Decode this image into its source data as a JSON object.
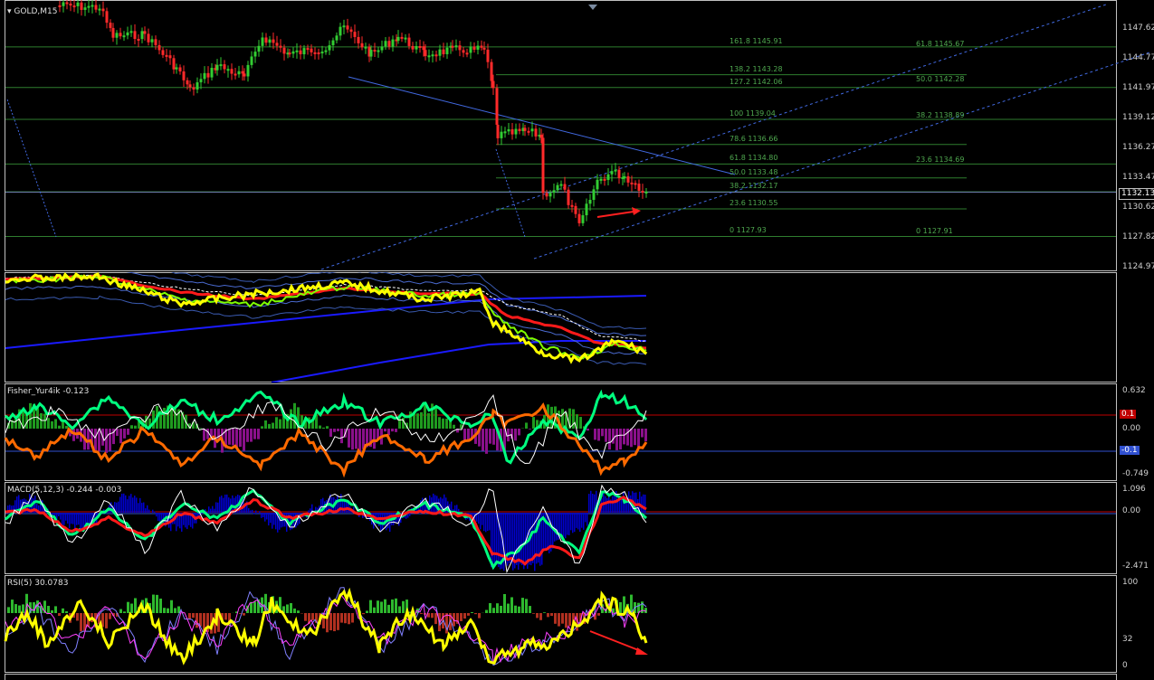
{
  "chart_title": "GOLD,M15",
  "price_axis": [
    "1147.62",
    "1144.77",
    "1141.97",
    "1139.12",
    "1136.27",
    "1133.47",
    "1130.62",
    "1127.82",
    "1124.97"
  ],
  "current_price": "1132.13",
  "fib_left": [
    {
      "label": "161.8 1145.91",
      "price": 1145.91
    },
    {
      "label": "138.2 1143.28",
      "price": 1143.28
    },
    {
      "label": "127.2 1142.06",
      "price": 1142.06
    },
    {
      "label": "100 1139.04",
      "price": 1139.04
    },
    {
      "label": "78.6 1136.66",
      "price": 1136.66
    },
    {
      "label": "61.8 1134.80",
      "price": 1134.8
    },
    {
      "label": "50.0 1133.48",
      "price": 1133.48
    },
    {
      "label": "38.2 1132.17",
      "price": 1132.17
    },
    {
      "label": "23.6 1130.55",
      "price": 1130.55
    },
    {
      "label": "0 1127.93",
      "price": 1127.93
    }
  ],
  "fib_right": [
    {
      "label": "61.8 1145.67",
      "price": 1145.67
    },
    {
      "label": "50.0 1142.28",
      "price": 1142.28
    },
    {
      "label": "38.2 1138.89",
      "price": 1138.89
    },
    {
      "label": "23.6 1134.69",
      "price": 1134.69
    },
    {
      "label": "0 1127.91",
      "price": 1127.91
    }
  ],
  "fisher": {
    "title": "Fisher_Yur4ik -0.123",
    "axis": [
      "0.632",
      "0.00",
      "-0.749"
    ],
    "upper_tag": "0.1",
    "lower_tag": "-0.1"
  },
  "macd": {
    "title": "MACD(5,12,3) -0.244 -0.003",
    "axis": [
      "1.096",
      "0.00",
      "-2.471"
    ]
  },
  "rsi": {
    "title": "RSI(5) 30.0783",
    "axis": [
      "100",
      "32",
      "0"
    ]
  },
  "colors": {
    "candle_up": "#32cd32",
    "candle_down": "#ff2a2a",
    "fib": "#2e7d2e",
    "trend": "#4169e1",
    "fisher_green": "#00ff7f",
    "fisher_orange": "#ff6a00",
    "macd_hist": "#0000cd",
    "rsi_line": "#ffff00",
    "arrow": "#ff2020"
  }
}
